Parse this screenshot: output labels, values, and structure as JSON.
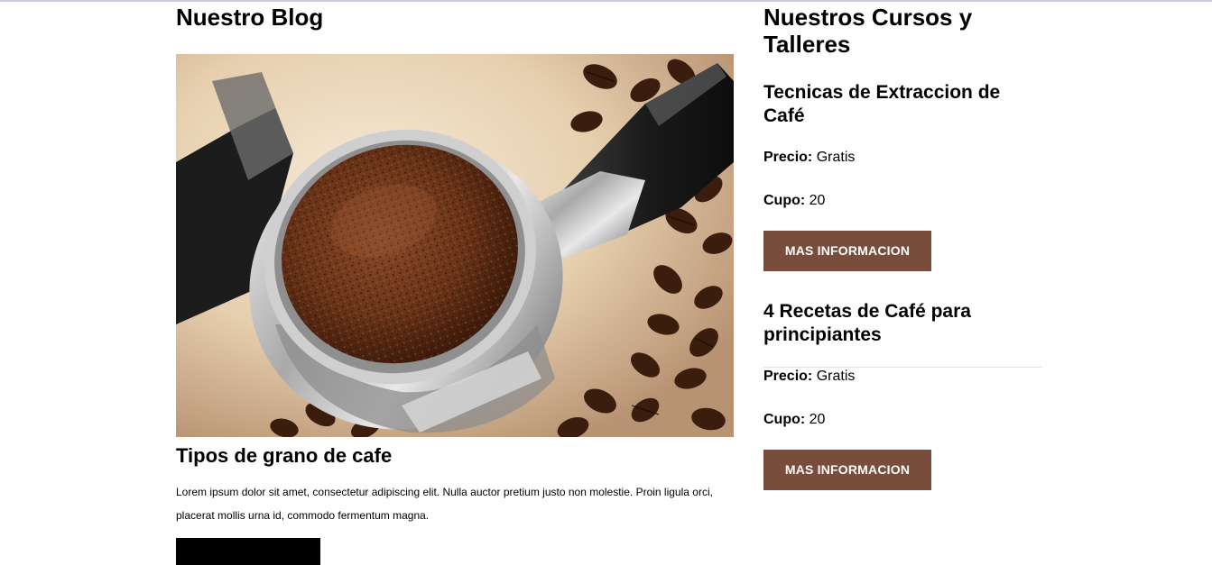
{
  "blog": {
    "heading": "Nuestro Blog",
    "image_subject": "coffee-portafilter-with-ground-coffee-photo",
    "post": {
      "title": "Tipos de grano de cafe",
      "excerpt": "Lorem ipsum dolor sit amet, consectetur adipiscing elit. Nulla auctor pretium justo non molestie. Proin ligula orci, placerat mollis urna id, commodo fermentum magna."
    }
  },
  "courses": {
    "heading": "Nuestros Cursos y Talleres",
    "items": [
      {
        "title": "Tecnicas de Extraccion de Café",
        "price_label": "Precio:",
        "price_value": "Gratis",
        "seats_label": "Cupo:",
        "seats_value": "20",
        "button_label": "MAS INFORMACION"
      },
      {
        "title": "4 Recetas de Café para principiantes",
        "price_label": "Precio:",
        "price_value": "Gratis",
        "seats_label": "Cupo:",
        "seats_value": "20",
        "button_label": "MAS INFORMACION"
      }
    ]
  },
  "colors": {
    "button_brown": "#784d3c",
    "post_button_black": "#000000",
    "divider": "#e3e3e3"
  }
}
